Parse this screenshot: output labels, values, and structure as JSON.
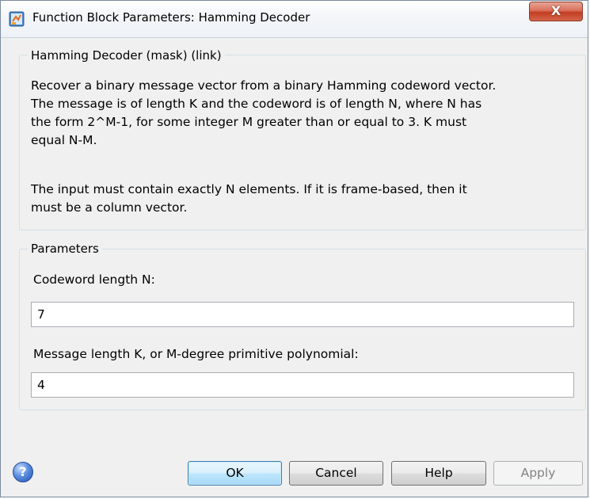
{
  "window": {
    "title": "Function Block Parameters: Hamming Decoder",
    "close_glyph": "X"
  },
  "mask_group": {
    "title": "Hamming Decoder (mask) (link)",
    "description_lines": [
      "Recover a binary message vector from a binary Hamming codeword vector.",
      "The message is of length K and the codeword is of length N, where N has",
      "the form 2^M-1, for some integer M greater than or equal to 3.  K must",
      "equal N-M.",
      "The input must contain exactly N elements.  If it is frame-based, then it",
      "must be a column vector."
    ]
  },
  "parameters_group": {
    "title": "Parameters",
    "codeword_length": {
      "label": "Codeword length N:",
      "value": "7"
    },
    "message_length": {
      "label": "Message length K, or M-degree primitive polynomial:",
      "value": "4"
    }
  },
  "buttons": {
    "help_glyph": "?",
    "ok": "OK",
    "cancel": "Cancel",
    "help": "Help",
    "apply": "Apply"
  },
  "icons": {
    "title": "simulink-block-icon",
    "help": "question-mark-icon",
    "close": "close-icon"
  },
  "colors": {
    "close_button": "#c9452b",
    "default_button_border": "#3c7fb1",
    "help_icon": "#3f73cc"
  }
}
